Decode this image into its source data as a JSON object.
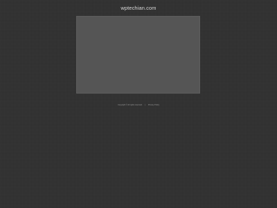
{
  "header": {
    "site_title": "wptechian.com"
  },
  "footer": {
    "copyright": "Copyright © All rights reserved.",
    "separator": "|",
    "privacy_link": "Privacy Policy"
  },
  "colors": {
    "background": "#323232",
    "panel": "#555555",
    "title_text": "#d8d8d8"
  }
}
